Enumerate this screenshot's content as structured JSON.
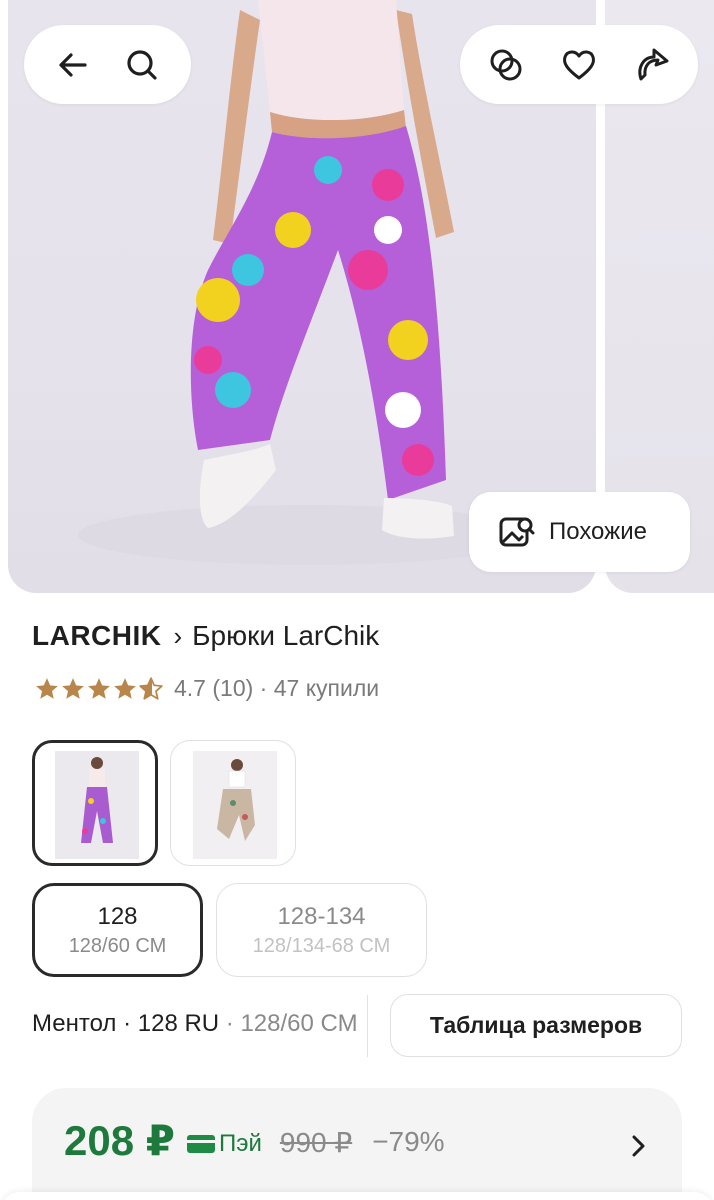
{
  "header": {
    "back_icon": "arrow-left-icon",
    "search_icon": "search-icon",
    "compare_icon": "compare-circles-icon",
    "favorite_icon": "heart-icon",
    "share_icon": "share-icon"
  },
  "gallery": {
    "similar_label": "Похожие",
    "similar_icon": "image-search-icon"
  },
  "product": {
    "brand": "LARCHIK",
    "separator": "›",
    "name": "Брюки LarChik",
    "rating": 4.7,
    "rating_text": "4.7",
    "reviews": "(10)",
    "dot": "·",
    "purchases": "47 купили"
  },
  "colors": {
    "items": [
      {
        "selected": true
      },
      {
        "selected": false
      }
    ]
  },
  "sizes": {
    "items": [
      {
        "main": "128",
        "sub": "128/60 СМ",
        "selected": true
      },
      {
        "main": "128-134",
        "sub": "128/134-68 СМ",
        "selected": false
      }
    ]
  },
  "selection": {
    "color_name": "Ментол",
    "sep1": " · ",
    "size_ru": "128 RU",
    "sep2": " · ",
    "size_cm": "128/60 СМ",
    "size_table_label": "Таблица размеров"
  },
  "price": {
    "current": "208 ₽",
    "pay_label": "Пэй",
    "old": "990 ₽",
    "discount": "−79%",
    "accent_color": "#1e7a3c"
  }
}
